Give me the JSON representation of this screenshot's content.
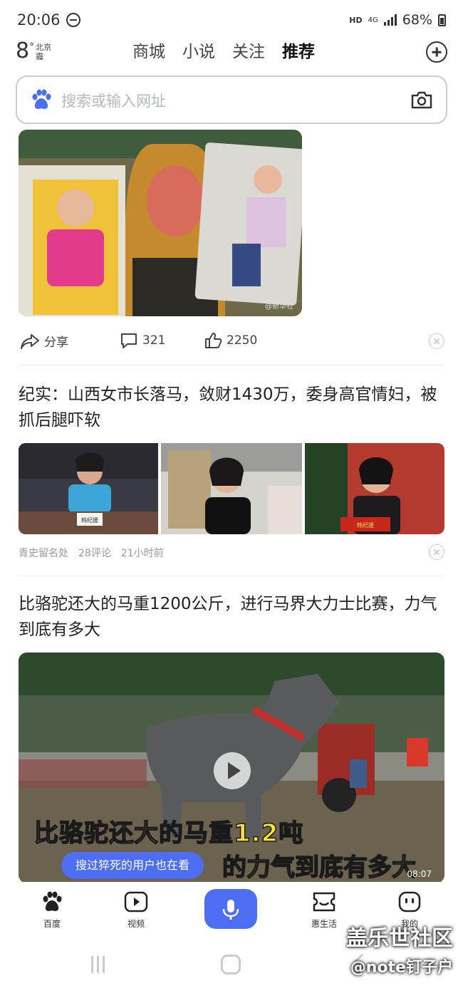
{
  "status_bar": {
    "time": "20:06",
    "hd": "HD",
    "network": "4G",
    "battery": "68%"
  },
  "weather": {
    "temp": "8",
    "degree": "°",
    "city": "北京",
    "condition": "霾"
  },
  "top_tabs": [
    {
      "label": "商城"
    },
    {
      "label": "小说"
    },
    {
      "label": "关注"
    },
    {
      "label": "推荐"
    }
  ],
  "search": {
    "placeholder": "搜索或输入网址"
  },
  "feed": [
    {
      "type": "image-post",
      "photo_tag": "@新华社",
      "share_label": "分享",
      "comments": "321",
      "likes": "2250"
    },
    {
      "type": "article",
      "title": "纪实：山西女市长落马，敛财1430万，委身高官情妇，被抓后腿吓软",
      "source": "青史留名处",
      "comments": "28评论",
      "time": "21小时前",
      "nameplate1": "韩纪援",
      "nameplate2": "韩纪援"
    },
    {
      "type": "video",
      "title": "比骆驼还大的马重1200公斤，进行马界大力士比赛，力气到底有多大",
      "overlay_line1": "比骆驼还大的马重1.2吨",
      "overlay_line2": "的力气到底有多大",
      "duration": "08:07",
      "watch_hint": "搜过猝死的用户也在看"
    }
  ],
  "bottom_nav": [
    {
      "label": "百度"
    },
    {
      "label": "视频"
    },
    {
      "label": "惠生活"
    },
    {
      "label": "我的"
    }
  ],
  "watermark": {
    "line1": "盖乐世社区",
    "line2": "@note钉子户"
  },
  "colors": {
    "accent": "#4e6ef2",
    "overlay_text": "#f8e33b"
  }
}
